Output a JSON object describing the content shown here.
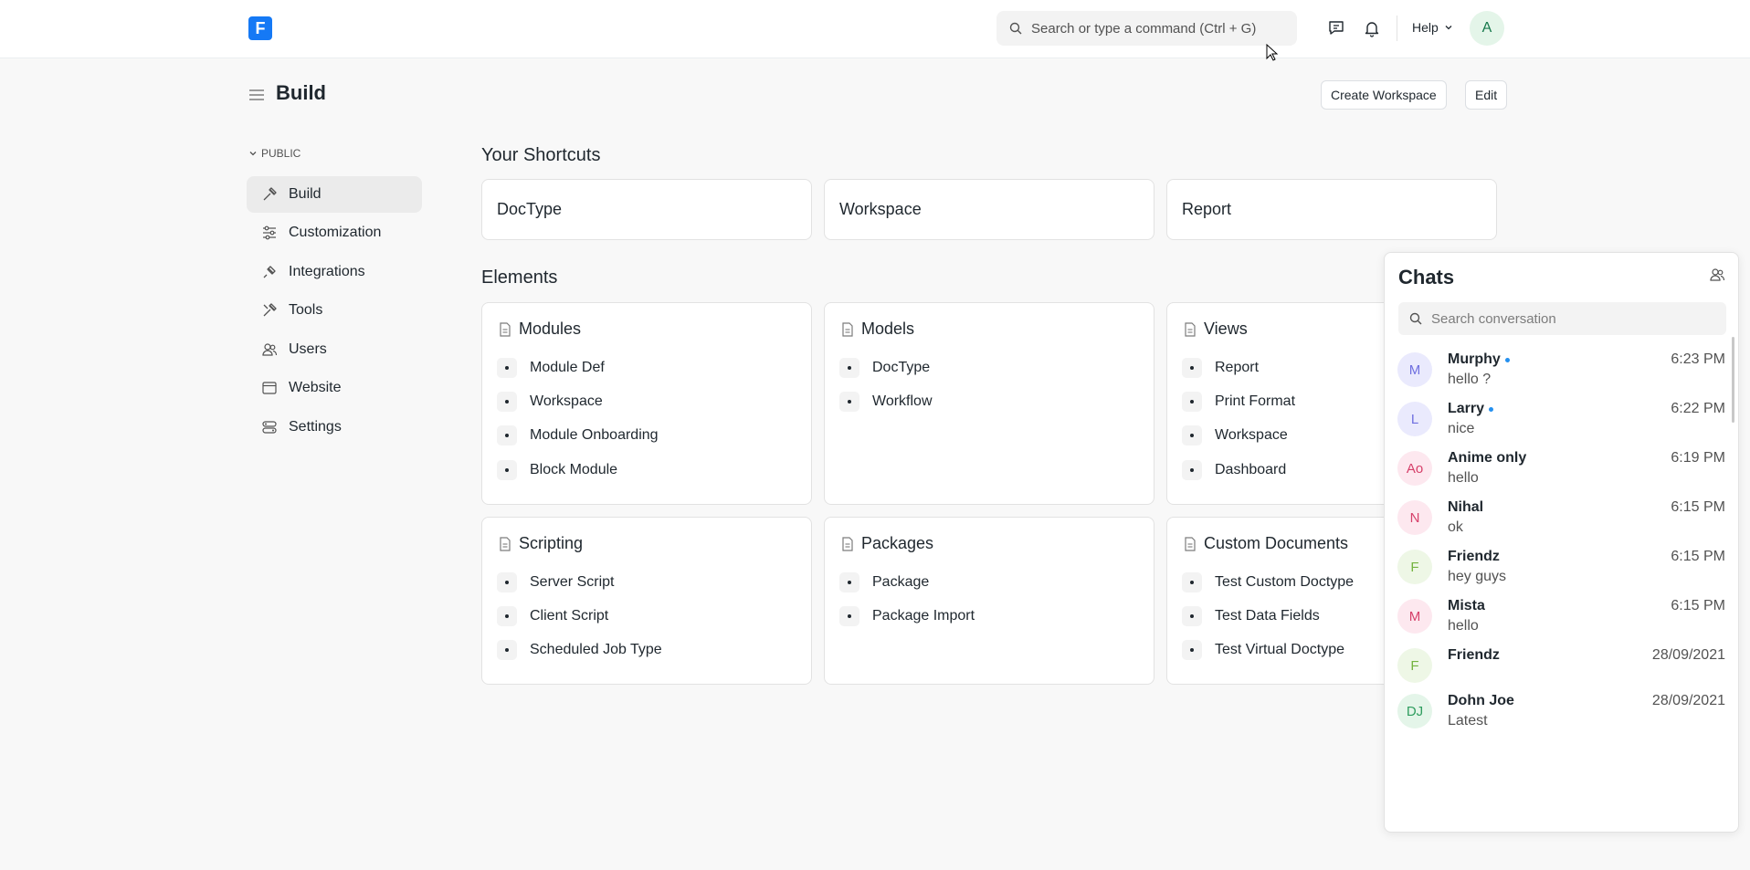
{
  "navbar": {
    "logo_letter": "F",
    "search_placeholder": "Search or type a command (Ctrl + G)",
    "help_label": "Help",
    "avatar_initial": "A"
  },
  "page": {
    "title": "Build",
    "create_workspace_label": "Create Workspace",
    "edit_label": "Edit"
  },
  "sidebar": {
    "section_label": "PUBLIC",
    "items": [
      {
        "label": "Build",
        "icon": "hammer-icon"
      },
      {
        "label": "Customization",
        "icon": "sliders-icon"
      },
      {
        "label": "Integrations",
        "icon": "plug-icon"
      },
      {
        "label": "Tools",
        "icon": "tools-icon"
      },
      {
        "label": "Users",
        "icon": "users-icon"
      },
      {
        "label": "Website",
        "icon": "browser-icon"
      },
      {
        "label": "Settings",
        "icon": "settings-icon"
      }
    ]
  },
  "shortcuts": {
    "title": "Your Shortcuts",
    "items": [
      "DocType",
      "Workspace",
      "Report"
    ]
  },
  "elements": {
    "title": "Elements",
    "cards": [
      {
        "title": "Modules",
        "links": [
          "Module Def",
          "Workspace",
          "Module Onboarding",
          "Block Module"
        ]
      },
      {
        "title": "Models",
        "links": [
          "DocType",
          "Workflow"
        ]
      },
      {
        "title": "Views",
        "links": [
          "Report",
          "Print Format",
          "Workspace",
          "Dashboard"
        ]
      },
      {
        "title": "Scripting",
        "links": [
          "Server Script",
          "Client Script",
          "Scheduled Job Type"
        ]
      },
      {
        "title": "Packages",
        "links": [
          "Package",
          "Package Import"
        ]
      },
      {
        "title": "Custom Documents",
        "links": [
          "Test Custom Doctype",
          "Test Data Fields",
          "Test Virtual Doctype"
        ]
      }
    ]
  },
  "chats": {
    "title": "Chats",
    "search_placeholder": "Search conversation",
    "rooms": [
      {
        "initials": "M",
        "name": "Murphy",
        "online": true,
        "message": "hello ?",
        "time": "6:23 PM",
        "bg": "#eaeafd",
        "fg": "#6f6fe0"
      },
      {
        "initials": "L",
        "name": "Larry",
        "online": true,
        "message": "nice",
        "time": "6:22 PM",
        "bg": "#eaeafd",
        "fg": "#6f6fe0"
      },
      {
        "initials": "Ao",
        "name": "Anime only",
        "online": false,
        "message": "hello",
        "time": "6:19 PM",
        "bg": "#fde8ef",
        "fg": "#d6406a"
      },
      {
        "initials": "N",
        "name": "Nihal",
        "online": false,
        "message": "ok",
        "time": "6:15 PM",
        "bg": "#fde8ef",
        "fg": "#d6406a"
      },
      {
        "initials": "F",
        "name": "Friendz",
        "online": false,
        "message": "hey guys",
        "time": "6:15 PM",
        "bg": "#eef7e6",
        "fg": "#74b33f"
      },
      {
        "initials": "M",
        "name": "Mista",
        "online": false,
        "message": "hello",
        "time": "6:15 PM",
        "bg": "#fde8ef",
        "fg": "#d6406a"
      },
      {
        "initials": "F",
        "name": "Friendz",
        "online": false,
        "message": "",
        "time": "28/09/2021",
        "bg": "#eef7e6",
        "fg": "#74b33f"
      },
      {
        "initials": "DJ",
        "name": "Dohn Joe",
        "online": false,
        "message": "Latest",
        "time": "28/09/2021",
        "bg": "#e4f5e9",
        "fg": "#2f9d5f"
      }
    ]
  }
}
